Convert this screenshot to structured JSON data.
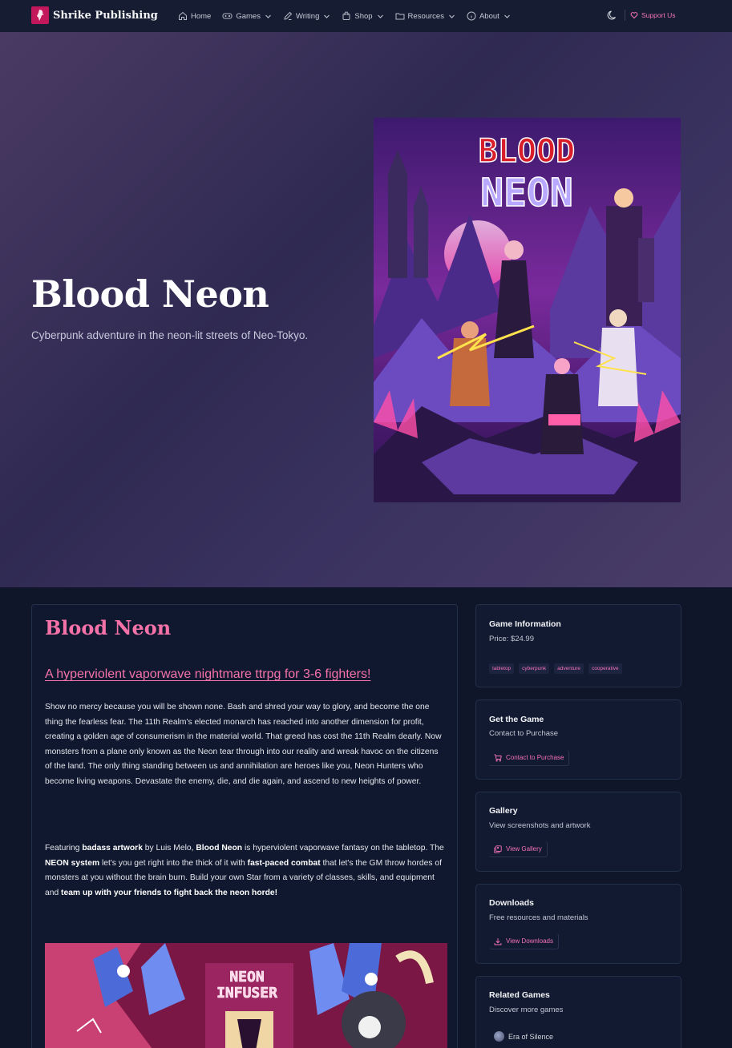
{
  "nav": {
    "brand": "Shrike Publishing",
    "items": [
      {
        "label": "Home",
        "icon": "home-icon",
        "has_dropdown": false
      },
      {
        "label": "Games",
        "icon": "gamepad-icon",
        "has_dropdown": true
      },
      {
        "label": "Writing",
        "icon": "pen-icon",
        "has_dropdown": true
      },
      {
        "label": "Shop",
        "icon": "bag-icon",
        "has_dropdown": true
      },
      {
        "label": "Resources",
        "icon": "folder-icon",
        "has_dropdown": true
      },
      {
        "label": "About",
        "icon": "info-icon",
        "has_dropdown": true
      }
    ],
    "theme_toggle_icon": "moon-icon",
    "support_label": "Support Us"
  },
  "hero": {
    "title": "Blood Neon",
    "subtitle": "Cyberpunk adventure in the neon-lit streets of Neo-Tokyo.",
    "cover_title_line1": "BLOOD",
    "cover_title_line2": "NEON"
  },
  "main": {
    "title": "Blood Neon",
    "tagline": "A hyperviolent vaporwave nightmare ttrpg for 3-6 fighters!",
    "paragraph1": "Show no mercy because you will be shown none. Bash and shred your way to glory, and become the one thing the fearless fear. The 11th Realm's elected monarch has reached into another dimension for profit, creating a golden age of consumerism in the material world. That greed has cost the 11th Realm dearly. Now monsters from a plane only known as the Neon tear through into our reality and wreak havoc on the citizens of the land. The only thing standing between us and annihilation are heroes like you, Neon Hunters who become living weapons. Devastate the enemy, die, and die again, and ascend to new heights of power.",
    "paragraph2": [
      {
        "text": "Featuring ",
        "bold": false
      },
      {
        "text": "badass artwork",
        "bold": true
      },
      {
        "text": " by Luis Melo, ",
        "bold": false
      },
      {
        "text": "Blood Neon",
        "bold": true
      },
      {
        "text": " is hyperviolent vaporwave fantasy on the tabletop. The ",
        "bold": false
      },
      {
        "text": "NEON system",
        "bold": true
      },
      {
        "text": " let's you get right into the thick of it with ",
        "bold": false
      },
      {
        "text": "fast-paced combat",
        "bold": true
      },
      {
        "text": " that let's the GM throw hordes of monsters at you without the brain burn. Build your own Star from a variety of classes, skills, and equipment and ",
        "bold": false
      },
      {
        "text": "team up with your friends to fight back the neon horde!",
        "bold": true
      }
    ],
    "banner_title_line1": "NEON",
    "banner_title_line2": "INFUSER"
  },
  "sidebar": {
    "info": {
      "title": "Game Information",
      "price": "Price: $24.99",
      "tags": [
        "tabletop",
        "cyberpunk",
        "adventure",
        "cooperative"
      ]
    },
    "get": {
      "title": "Get the Game",
      "text": "Contact to Purchase",
      "button": "Contact to Purchase",
      "icon": "cart-icon"
    },
    "gallery": {
      "title": "Gallery",
      "text": "View screenshots and artwork",
      "button": "View Gallery",
      "icon": "images-icon"
    },
    "downloads": {
      "title": "Downloads",
      "text": "Free resources and materials",
      "button": "View Downloads",
      "icon": "download-icon"
    },
    "related": {
      "title": "Related Games",
      "text": "Discover more games",
      "items": [
        "Era of Silence"
      ]
    }
  },
  "colors": {
    "accent": "#f472b6",
    "title_pink": "#f472a8",
    "background": "#0f1629",
    "nav_bg": "#161d33"
  }
}
